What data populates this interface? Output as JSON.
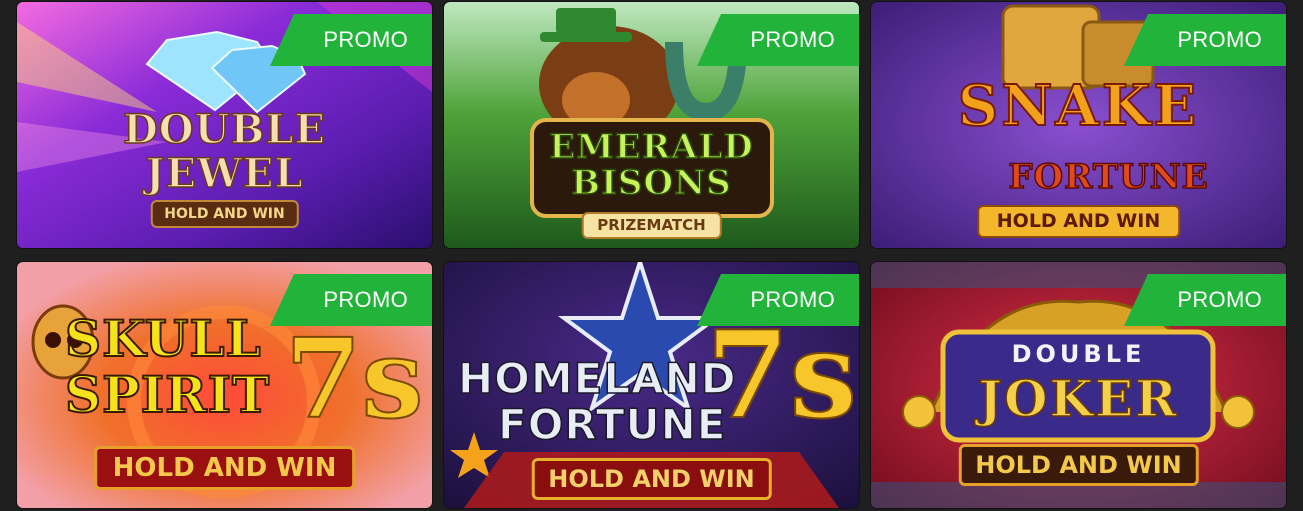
{
  "promo_label": "PROMO",
  "games": [
    {
      "title_lines": [
        "DOUBLE",
        "JEWEL"
      ],
      "subtitle": "HOLD AND WIN"
    },
    {
      "title_lines": [
        "EMERALD",
        "BISONS"
      ],
      "subtitle": "PRIZEMATCH"
    },
    {
      "title_lines": [
        "SNAKE",
        "FORTUNE"
      ],
      "subtitle": "HOLD AND WIN"
    },
    {
      "title_lines": [
        "SKULL",
        "SPIRIT"
      ],
      "subtitle": "HOLD AND WIN",
      "badge": "7s"
    },
    {
      "title_lines": [
        "HOMELAND",
        "FORTUNE"
      ],
      "subtitle": "HOLD AND WIN",
      "badge": "7s"
    },
    {
      "title_lines": [
        "DOUBLE",
        "JOKER"
      ],
      "subtitle": "HOLD AND WIN"
    }
  ],
  "colors": {
    "page_background": "#1f1f1f",
    "promo_badge": "#22b43a",
    "promo_text": "#ffffff"
  },
  "icons": [
    "diamond-icon",
    "bison-icon",
    "horseshoe-icon",
    "dice-icon",
    "skull-icon",
    "star-icon",
    "jester-hat-icon"
  ]
}
